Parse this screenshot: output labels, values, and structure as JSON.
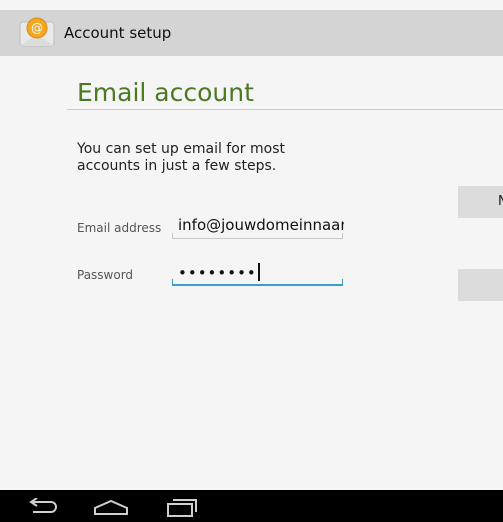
{
  "header": {
    "icon": "email-at-icon",
    "title": "Account setup"
  },
  "main": {
    "title": "Email account",
    "intro": "You can set up email for most accounts in just a few steps.",
    "email": {
      "label": "Email address",
      "value": "info@jouwdomeinnaam"
    },
    "password": {
      "label": "Password",
      "value": "••••••••"
    }
  },
  "buttons": {
    "next_label": "N"
  },
  "navbar": {
    "icons": [
      "back-icon",
      "home-icon",
      "recent-apps-icon"
    ]
  },
  "colors": {
    "accent": "#4c7a21",
    "focus": "#3aa0c8",
    "header_bg": "#d4d4d4",
    "navbar_bg": "#000000"
  }
}
